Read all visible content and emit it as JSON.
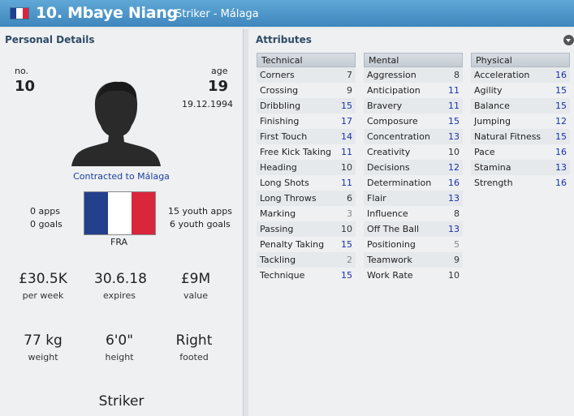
{
  "header": {
    "title": "10. Mbaye Niang",
    "subtitle": "Striker - Málaga",
    "flag_colors": [
      "#1f3f8f",
      "#ffffff",
      "#d9263b"
    ]
  },
  "personal": {
    "section_title": "Personal Details",
    "no_label": "no.",
    "no_value": "10",
    "age_label": "age",
    "age_value": "19",
    "dob": "19.12.1994",
    "contract_text": "Contracted to Málaga",
    "apps": "0 apps",
    "goals": "0 goals",
    "youth_apps": "15 youth apps",
    "youth_goals": "6 youth goals",
    "nationality": "FRA",
    "wage_value": "£30.5K",
    "wage_label": "per week",
    "expires_value": "30.6.18",
    "expires_label": "expires",
    "value_value": "£9M",
    "value_label": "value",
    "weight_value": "77 kg",
    "weight_label": "weight",
    "height_value": "6'0\"",
    "height_label": "height",
    "footed_value": "Right",
    "footed_label": "footed",
    "position": "Striker"
  },
  "attributes": {
    "section_title": "Attributes",
    "technical": {
      "title": "Technical",
      "items": [
        {
          "name": "Corners",
          "value": "7",
          "level": "md"
        },
        {
          "name": "Crossing",
          "value": "9",
          "level": "md"
        },
        {
          "name": "Dribbling",
          "value": "15",
          "level": "hi"
        },
        {
          "name": "Finishing",
          "value": "17",
          "level": "hi"
        },
        {
          "name": "First Touch",
          "value": "14",
          "level": "hi"
        },
        {
          "name": "Free Kick Taking",
          "value": "11",
          "level": "hi"
        },
        {
          "name": "Heading",
          "value": "10",
          "level": "md"
        },
        {
          "name": "Long Shots",
          "value": "11",
          "level": "hi"
        },
        {
          "name": "Long Throws",
          "value": "6",
          "level": "md"
        },
        {
          "name": "Marking",
          "value": "3",
          "level": "lo"
        },
        {
          "name": "Passing",
          "value": "10",
          "level": "md"
        },
        {
          "name": "Penalty Taking",
          "value": "15",
          "level": "hi"
        },
        {
          "name": "Tackling",
          "value": "2",
          "level": "lo"
        },
        {
          "name": "Technique",
          "value": "15",
          "level": "hi"
        }
      ]
    },
    "mental": {
      "title": "Mental",
      "items": [
        {
          "name": "Aggression",
          "value": "8",
          "level": "md"
        },
        {
          "name": "Anticipation",
          "value": "11",
          "level": "hi"
        },
        {
          "name": "Bravery",
          "value": "11",
          "level": "hi"
        },
        {
          "name": "Composure",
          "value": "15",
          "level": "hi"
        },
        {
          "name": "Concentration",
          "value": "13",
          "level": "hi"
        },
        {
          "name": "Creativity",
          "value": "10",
          "level": "md"
        },
        {
          "name": "Decisions",
          "value": "12",
          "level": "hi"
        },
        {
          "name": "Determination",
          "value": "16",
          "level": "hi"
        },
        {
          "name": "Flair",
          "value": "13",
          "level": "hi"
        },
        {
          "name": "Influence",
          "value": "8",
          "level": "md"
        },
        {
          "name": "Off The Ball",
          "value": "13",
          "level": "hi"
        },
        {
          "name": "Positioning",
          "value": "5",
          "level": "lo"
        },
        {
          "name": "Teamwork",
          "value": "9",
          "level": "md"
        },
        {
          "name": "Work Rate",
          "value": "10",
          "level": "md"
        }
      ]
    },
    "physical": {
      "title": "Physical",
      "items": [
        {
          "name": "Acceleration",
          "value": "16",
          "level": "hi"
        },
        {
          "name": "Agility",
          "value": "15",
          "level": "hi"
        },
        {
          "name": "Balance",
          "value": "15",
          "level": "hi"
        },
        {
          "name": "Jumping",
          "value": "12",
          "level": "hi"
        },
        {
          "name": "Natural Fitness",
          "value": "15",
          "level": "hi"
        },
        {
          "name": "Pace",
          "value": "16",
          "level": "hi"
        },
        {
          "name": "Stamina",
          "value": "13",
          "level": "hi"
        },
        {
          "name": "Strength",
          "value": "16",
          "level": "hi"
        }
      ]
    }
  }
}
